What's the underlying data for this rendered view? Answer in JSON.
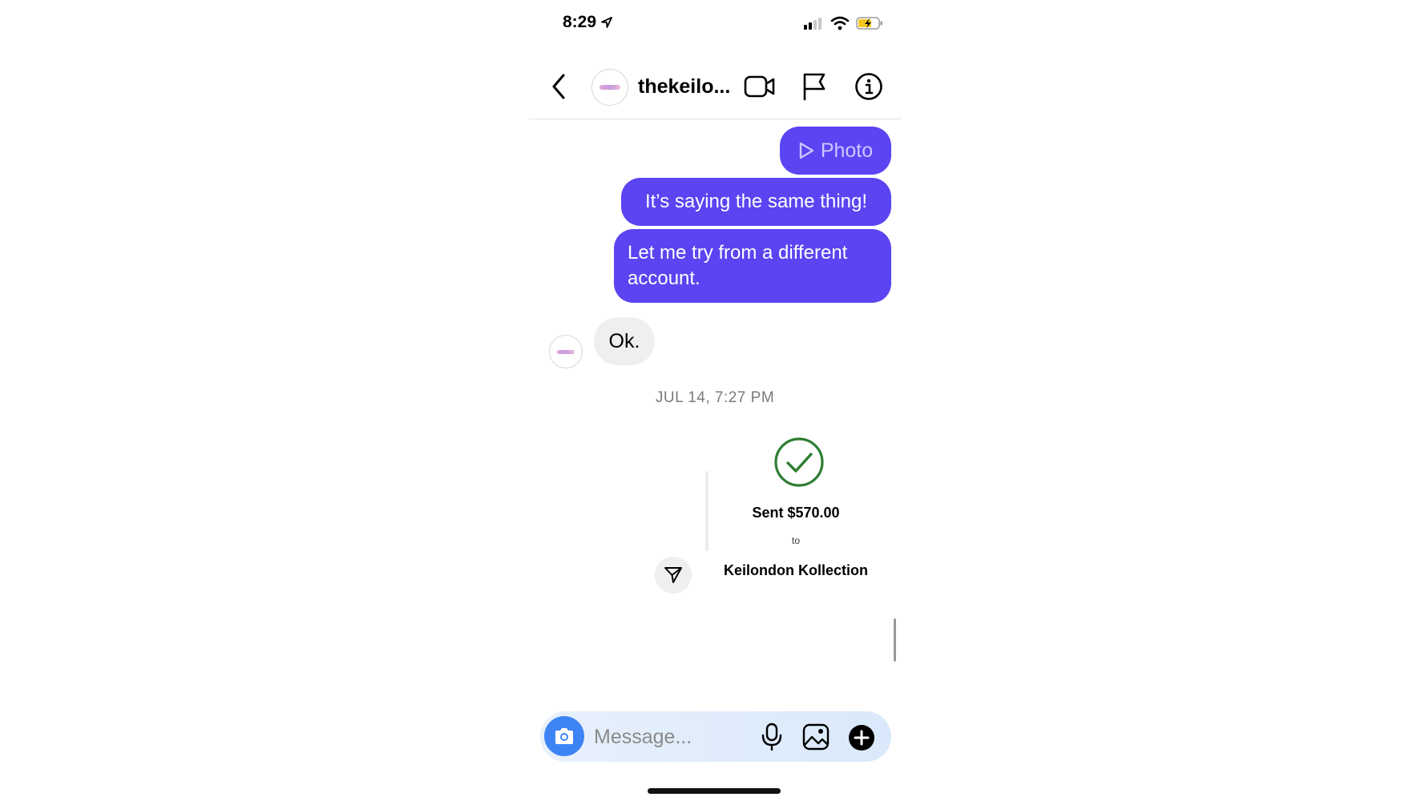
{
  "status_bar": {
    "time": "8:29"
  },
  "header": {
    "username": "thekeilo..."
  },
  "messages": {
    "photo_label": "Photo",
    "outgoing_1": "It’s saying the same thing!",
    "outgoing_2": "Let me try from a different account.",
    "incoming_1": "Ok."
  },
  "timestamp": "JUL 14, 7:27 PM",
  "payment": {
    "title": "Sent $570.00",
    "to_label": "to",
    "recipient": "Keilondon Kollection",
    "status_color": "#2e7d32"
  },
  "composer": {
    "placeholder": "Message..."
  },
  "colors": {
    "outgoing_bubble": "#5b44f2",
    "incoming_bubble": "#efefef",
    "camera_button": "#3d84f5"
  }
}
